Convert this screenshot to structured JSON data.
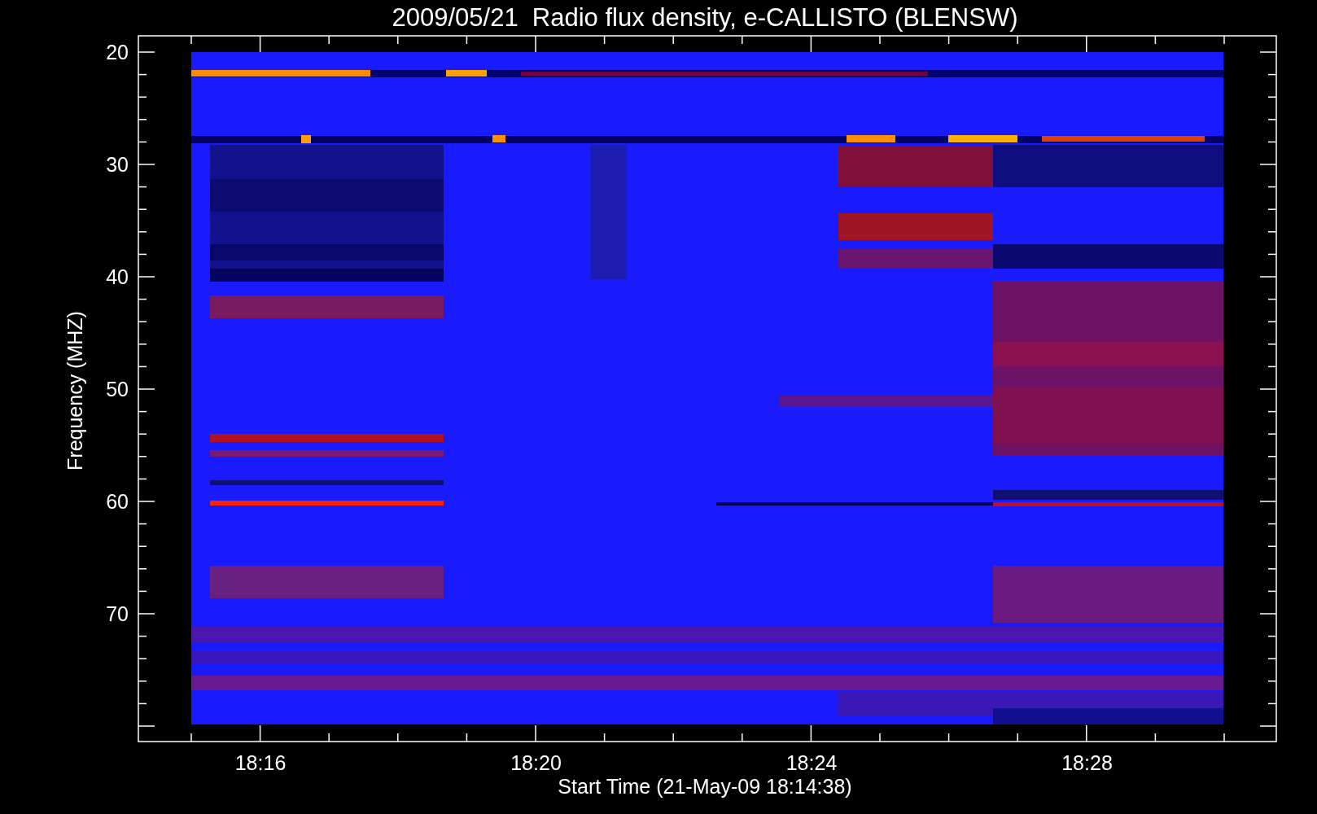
{
  "title": "2009/05/21  Radio flux density, e-CALLISTO (BLENSW)",
  "y_axis": {
    "label": "Frequency (MHZ)",
    "ticks": [
      "20",
      "30",
      "40",
      "50",
      "60",
      "70"
    ]
  },
  "x_axis": {
    "label": "Start Time (21-May-09 18:14:38)",
    "ticks": [
      "18:16",
      "18:20",
      "18:24",
      "18:28"
    ]
  }
}
